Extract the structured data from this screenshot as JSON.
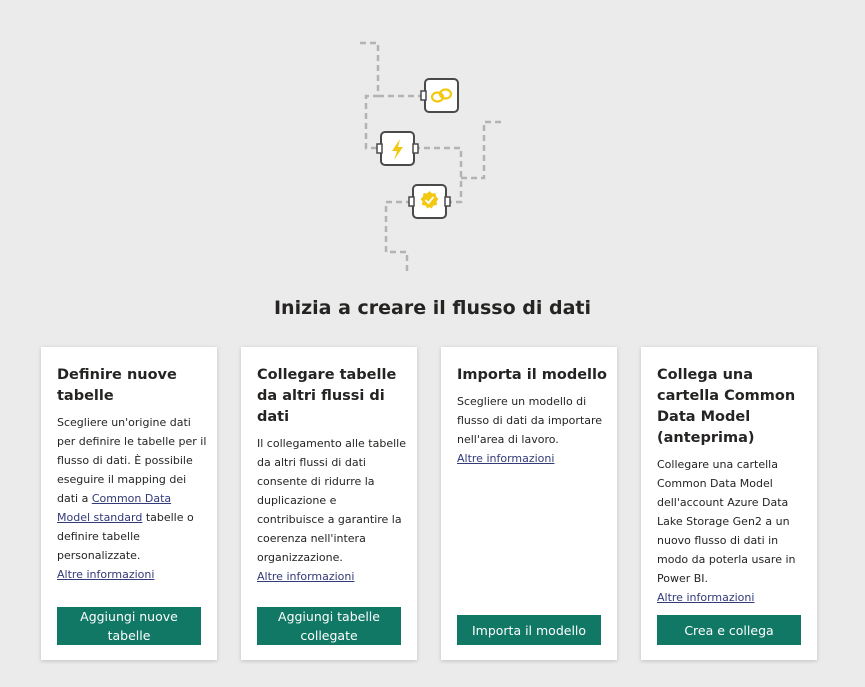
{
  "title": "Inizia a creare il flusso di dati",
  "cards": [
    {
      "title": "Definire nuove tabelle",
      "desc_before": "Scegliere un'origine dati per definire le tabelle per il flusso di dati. È possibile eseguire il mapping dei dati a ",
      "desc_link": "Common Data Model standard",
      "desc_after": " tabelle o definire tabelle personalizzate.",
      "more": "Altre informazioni",
      "button": "Aggiungi nuove tabelle"
    },
    {
      "title": "Collegare tabelle da altri flussi di dati",
      "desc": "Il collegamento alle tabelle da altri flussi di dati consente di ridurre la duplicazione e contribuisce a garantire la coerenza nell'intera organizzazione.",
      "more": "Altre informazioni",
      "button": "Aggiungi tabelle collegate"
    },
    {
      "title": "Importa il modello",
      "desc": "Scegliere un modello di flusso di dati da importare nell'area di lavoro.",
      "more": "Altre informazioni",
      "button": "Importa il modello"
    },
    {
      "title": "Collega una cartella Common Data Model (anteprima)",
      "desc": "Collegare una cartella Common Data Model dell'account Azure Data Lake Storage Gen2 a un nuovo flusso di dati in modo da poterla usare in Power BI.",
      "more": "Altre informazioni",
      "button": "Crea e collega"
    }
  ],
  "icons": [
    "link-icon",
    "lightning-icon",
    "badge-check-icon"
  ],
  "colors": {
    "accent": "#117865",
    "icon_yellow": "#f2c811",
    "link": "#333a78",
    "background": "#ebebeb"
  }
}
